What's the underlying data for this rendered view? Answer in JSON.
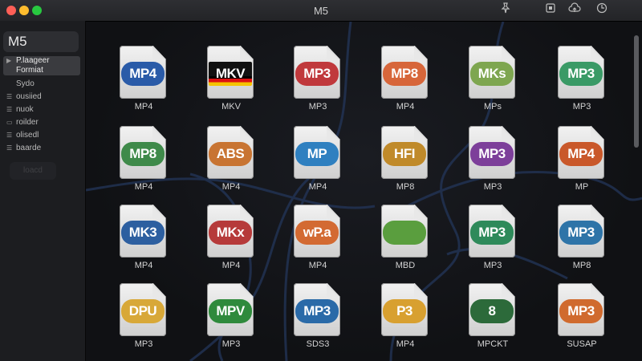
{
  "window": {
    "title": "M5"
  },
  "toolbar": {
    "icons": [
      "pin-icon",
      "window-icon",
      "cloud-upload-icon",
      "power-icon"
    ]
  },
  "sidebar": {
    "title": "M5",
    "items": [
      {
        "label": "P.laageer",
        "icon": "disclosure-arrow-icon"
      },
      {
        "label": "Formiat",
        "icon": ""
      },
      {
        "label": "Sydo",
        "icon": ""
      },
      {
        "label": "ousiied",
        "icon": "list-icon"
      },
      {
        "label": "nuok",
        "icon": "list-icon"
      },
      {
        "label": "roilder",
        "icon": "monitor-icon"
      },
      {
        "label": "olisedl",
        "icon": "list-icon"
      },
      {
        "label": "baarde",
        "icon": "list-icon"
      }
    ],
    "button_label": "loacd"
  },
  "files": [
    {
      "badge": "MP4",
      "caption": "MP4",
      "color": "#2a5ba8"
    },
    {
      "badge": "MKV",
      "caption": "MKV",
      "color": "#111111"
    },
    {
      "badge": "MP3",
      "caption": "MP3",
      "color": "#c0393c"
    },
    {
      "badge": "MP8",
      "caption": "MP4",
      "color": "#d7663a"
    },
    {
      "badge": "MKs",
      "caption": "MPs",
      "color": "#7ea650"
    },
    {
      "badge": "MP3",
      "caption": "MP3",
      "color": "#3a9a66"
    },
    {
      "badge": "MP8",
      "caption": "MP4",
      "color": "#3f8a4a"
    },
    {
      "badge": "ABS",
      "caption": "MP4",
      "color": "#c87432"
    },
    {
      "badge": "MP",
      "caption": "MP4",
      "color": "#2f80c0"
    },
    {
      "badge": "HFI",
      "caption": "MP8",
      "color": "#c08a2a"
    },
    {
      "badge": "MP3",
      "caption": "MP3",
      "color": "#7d3f9a"
    },
    {
      "badge": "MP4",
      "caption": "MP",
      "color": "#c9582a"
    },
    {
      "badge": "MK3",
      "caption": "MP4",
      "color": "#2d5fa0"
    },
    {
      "badge": "MKx",
      "caption": "MP4",
      "color": "#b63a3a"
    },
    {
      "badge": "wP.a",
      "caption": "MP4",
      "color": "#d36a32"
    },
    {
      "badge": "",
      "caption": "MBD",
      "color": "#5a9e3e"
    },
    {
      "badge": "MP3",
      "caption": "MP3",
      "color": "#2e8a5a"
    },
    {
      "badge": "MP3",
      "caption": "MP8",
      "color": "#2e74a8"
    },
    {
      "badge": "DPU",
      "caption": "MP3",
      "color": "#d8a838"
    },
    {
      "badge": "MPV",
      "caption": "MP3",
      "color": "#2f8a3c"
    },
    {
      "badge": "MP3",
      "caption": "SDS3",
      "color": "#2a6aa8"
    },
    {
      "badge": "P3",
      "caption": "MP4",
      "color": "#d8a030"
    },
    {
      "badge": "8",
      "caption": "MPCKT",
      "color": "#2c6a3a"
    },
    {
      "badge": "MP3",
      "caption": "SUSAP",
      "color": "#d06a2e"
    }
  ]
}
